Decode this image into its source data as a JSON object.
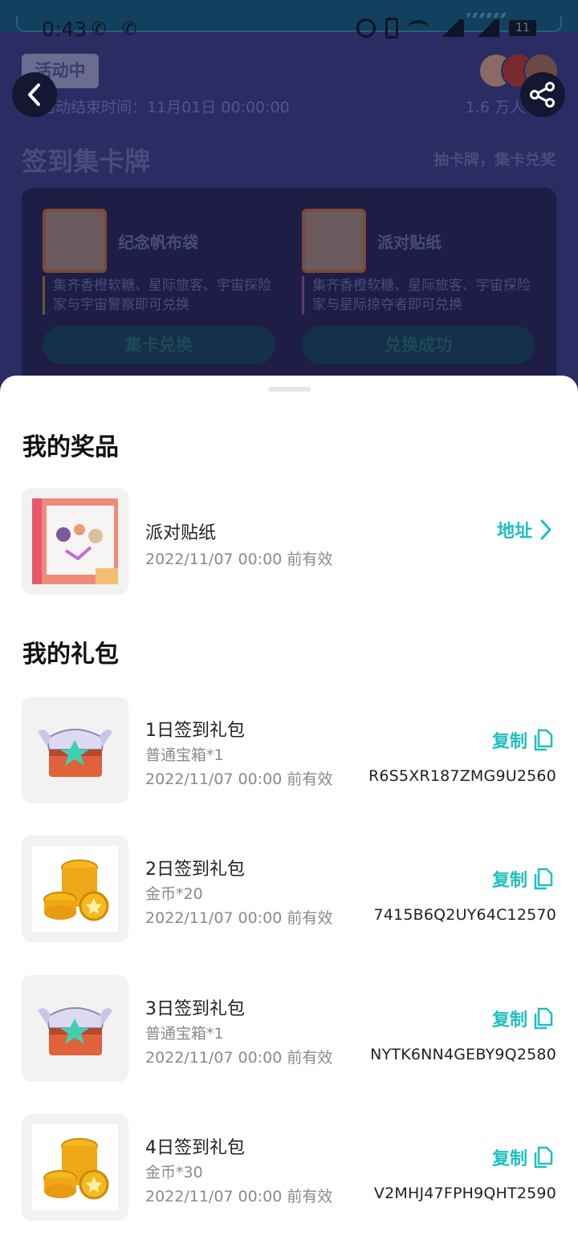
{
  "status_bar": {
    "time": "0:43",
    "carrier_glyphs": "✆ ✆",
    "battery": "11"
  },
  "event": {
    "badge": "活动中",
    "end_time": "活动结束时间：11月01日 00:00:00",
    "participants": "1.6 万人",
    "section_title": "签到集卡牌",
    "section_hint": "抽卡牌，集卡兑奖",
    "cards": [
      {
        "name": "纪念帆布袋",
        "desc": "集齐香橙软糖、星际旅客、宇宙探险家与宇宙警察即可兑换",
        "button": "集卡兑换"
      },
      {
        "name": "派对贴纸",
        "desc": "集齐香橙软糖、星际旅客、宇宙探险家与星际掠夺者即可兑换",
        "button": "兑换成功"
      }
    ]
  },
  "prizes": {
    "title": "我的奖品",
    "items": [
      {
        "name": "派对贴纸",
        "valid": "2022/11/07 00:00 前有效",
        "action": "地址",
        "thumb_icon": "sticker-sheet-icon"
      }
    ]
  },
  "gifts": {
    "title": "我的礼包",
    "items": [
      {
        "name": "1日签到礼包",
        "content": "普通宝箱*1",
        "valid": "2022/11/07 00:00 前有效",
        "action": "复制",
        "code": "R6S5XR187ZMG9U2560",
        "thumb_icon": "treasure-chest-icon"
      },
      {
        "name": "2日签到礼包",
        "content": "金币*20",
        "valid": "2022/11/07 00:00 前有效",
        "action": "复制",
        "code": "7415B6Q2UY64C12570",
        "thumb_icon": "gold-coins-icon"
      },
      {
        "name": "3日签到礼包",
        "content": "普通宝箱*1",
        "valid": "2022/11/07 00:00 前有效",
        "action": "复制",
        "code": "NYTK6NN4GEBY9Q2580",
        "thumb_icon": "treasure-chest-icon"
      },
      {
        "name": "4日签到礼包",
        "content": "金币*30",
        "valid": "2022/11/07 00:00 前有效",
        "action": "复制",
        "code": "V2MHJ47FPH9QHT2590",
        "thumb_icon": "gold-coins-icon"
      }
    ]
  },
  "colors": {
    "accent": "#1fbfbf",
    "sheet_bg": "#ffffff",
    "page_bg": "#2b2c63"
  }
}
